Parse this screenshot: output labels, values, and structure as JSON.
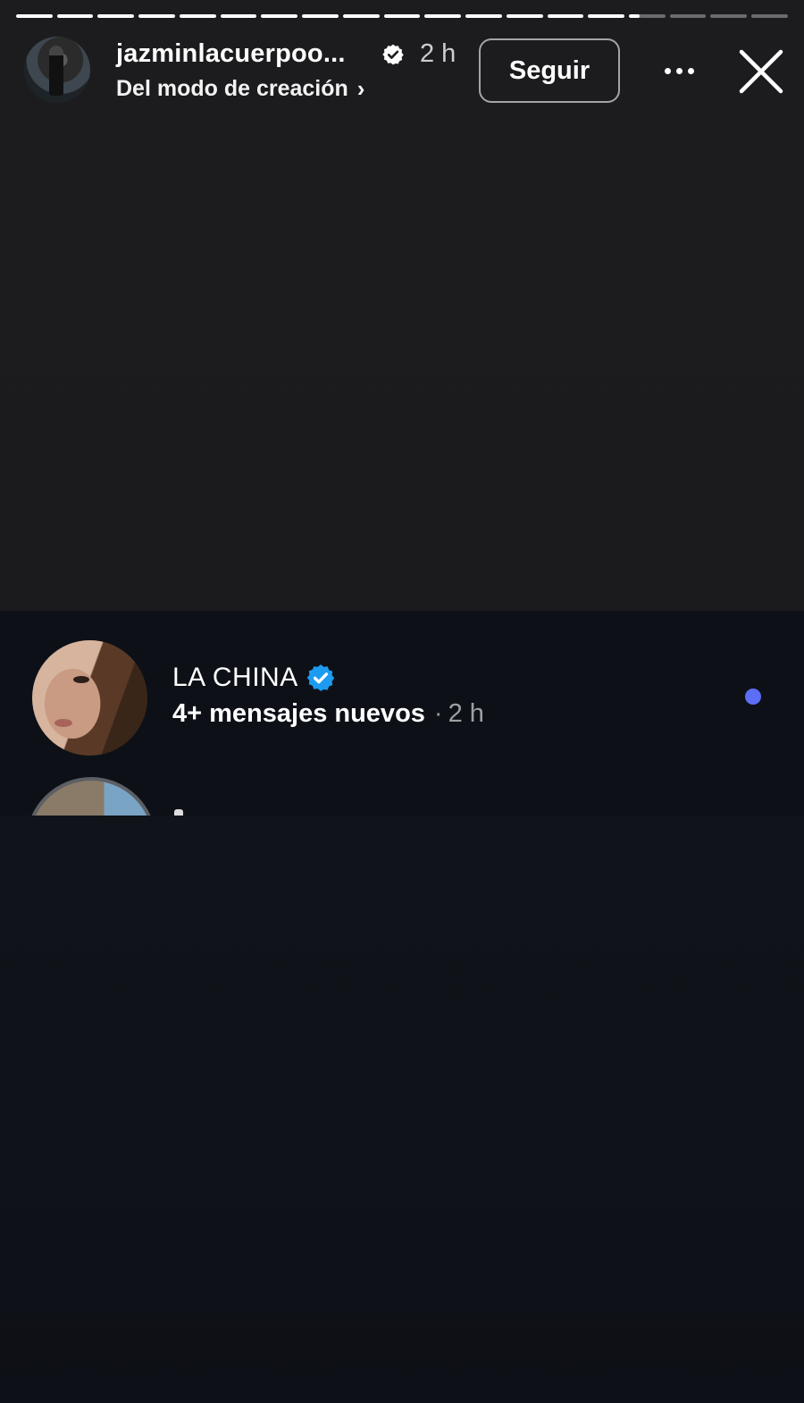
{
  "story": {
    "progress": {
      "segments_total": 19,
      "segments_complete": 15,
      "current_segment_fraction": 0.3
    }
  },
  "header": {
    "username": "jazminlacuerpoo...",
    "verified": true,
    "time": "2 h",
    "subtitle": "Del modo de creación",
    "subtitle_chevron": "›",
    "follow_label": "Seguir",
    "more_icon": "more-horizontal-icon",
    "close_icon": "close-icon"
  },
  "notification": {
    "sender": "LA CHINA",
    "sender_verified": true,
    "message": "4+ mensajes nuevos",
    "separator": "·",
    "time": "2 h",
    "unread": true
  },
  "colors": {
    "background": "#1b1b1d",
    "card": "#0d1117",
    "unread_dot": "#5b6ef5",
    "verified_blue": "#1d9bf0"
  }
}
